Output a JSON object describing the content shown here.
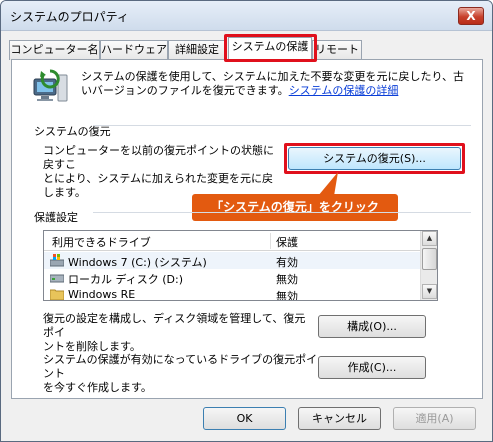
{
  "window": {
    "title": "システムのプロパティ",
    "close_glyph": "X"
  },
  "tabs": [
    {
      "label": "コンピューター名"
    },
    {
      "label": "ハードウェア"
    },
    {
      "label": "詳細設定"
    },
    {
      "label": "システムの保護"
    },
    {
      "label": "リモート"
    }
  ],
  "protection": {
    "description": "システムの保護を使用して、システムに加えた不要な変更を元に戻したり、古いバージョンのファイルを復元できます。",
    "details_link": "システムの保護の詳細"
  },
  "restore": {
    "group_label": "システムの復元",
    "text_line1": "コンピューターを以前の復元ポイントの状態に戻すこ",
    "text_line2": "とにより、システムに加えられた変更を元に戻します。",
    "button_label": "システムの復元(S)..."
  },
  "callout": {
    "text": "「システムの復元」をクリック"
  },
  "settings": {
    "group_label": "保護設定",
    "columns": [
      "利用できるドライブ",
      "保護"
    ],
    "drives": [
      {
        "name": "Windows 7 (C:) (システム)",
        "status": "有効",
        "icon": "os-drive-icon"
      },
      {
        "name": "ローカル ディスク (D:)",
        "status": "無効",
        "icon": "hard-disk-icon"
      },
      {
        "name": "Windows RE",
        "status": "無効",
        "icon": "folder-icon"
      }
    ],
    "configure_text": "復元の設定を構成し、ディスク領域を管理して、復元ポイントを削除します。",
    "configure_line1": "復元の設定を構成し、ディスク領域を管理して、復元ポイ",
    "configure_line2": "ントを削除します。",
    "configure_button": "構成(O)...",
    "create_line1": "システムの保護が有効になっているドライブの復元ポイント",
    "create_line2": "を今すぐ作成します。",
    "create_button": "作成(C)..."
  },
  "footer": {
    "ok": "OK",
    "cancel": "キャンセル",
    "apply": "適用(A)"
  },
  "colors": {
    "highlight": "#e0101c",
    "callout": "#e35a10",
    "link": "#0a3ed8"
  }
}
